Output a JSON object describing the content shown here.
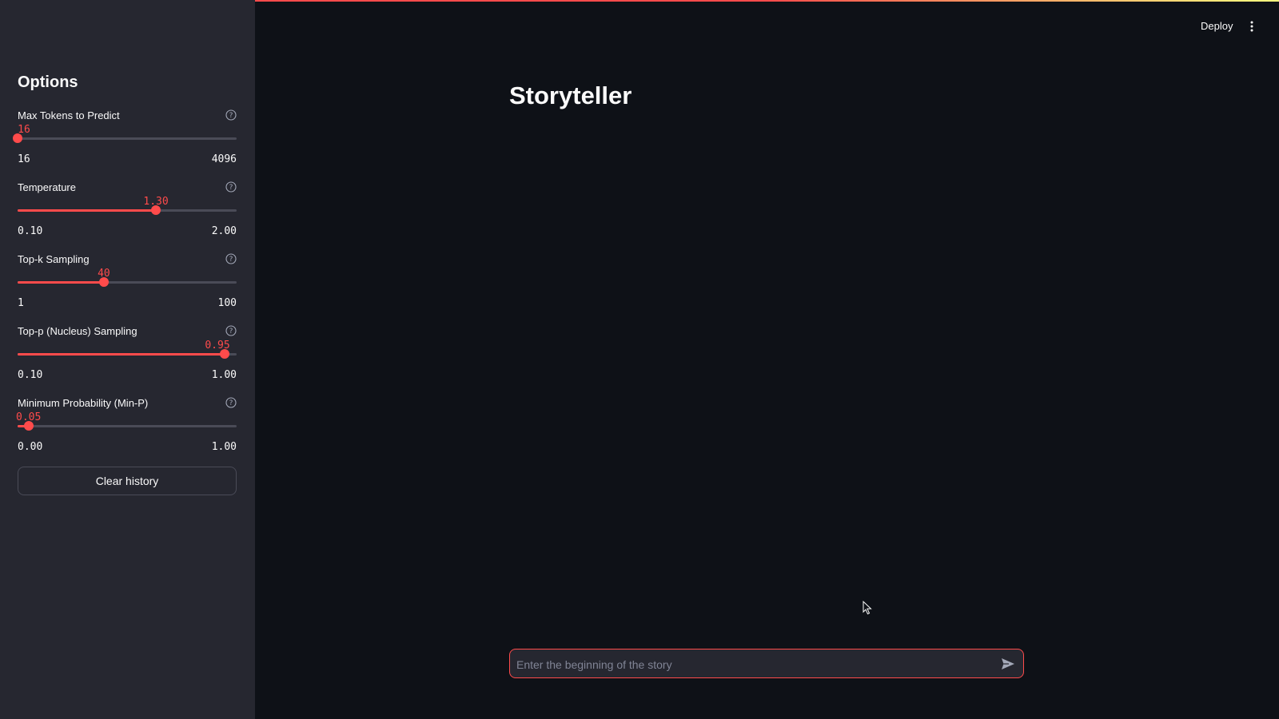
{
  "sidebar": {
    "title": "Options",
    "sliders": [
      {
        "label": "Max Tokens to Predict",
        "value": "16",
        "min": "16",
        "max": "4096",
        "fraction": 0.0
      },
      {
        "label": "Temperature",
        "value": "1.30",
        "min": "0.10",
        "max": "2.00",
        "fraction": 0.6316
      },
      {
        "label": "Top-k Sampling",
        "value": "40",
        "min": "1",
        "max": "100",
        "fraction": 0.3939
      },
      {
        "label": "Top-p (Nucleus) Sampling",
        "value": "0.95",
        "min": "0.10",
        "max": "1.00",
        "fraction": 0.9444
      },
      {
        "label": "Minimum Probability (Min-P)",
        "value": "0.05",
        "min": "0.00",
        "max": "1.00",
        "fraction": 0.05
      }
    ],
    "clear_button_label": "Clear history"
  },
  "header": {
    "deploy_label": "Deploy",
    "menu_icon": "kebab-menu-icon"
  },
  "main": {
    "title": "Storyteller"
  },
  "chat_input": {
    "placeholder": "Enter the beginning of the story",
    "value": ""
  },
  "colors": {
    "accent": "#ff4b4b",
    "background": "#0e1117",
    "sidebar_background": "#262730"
  }
}
